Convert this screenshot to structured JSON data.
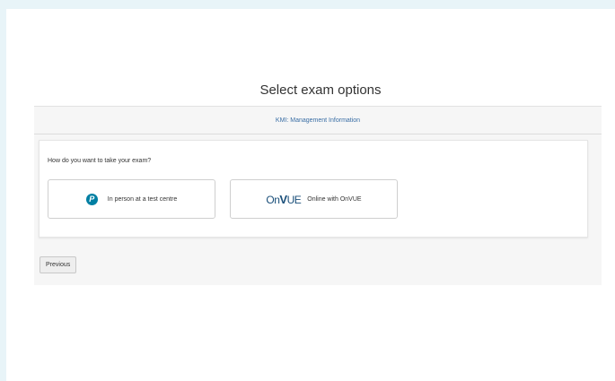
{
  "page": {
    "title": "Select exam options"
  },
  "exam": {
    "name": "KMI: Management Information"
  },
  "question": {
    "text": "How do you want to take your exam?",
    "options": [
      {
        "label": "In person at a test centre",
        "icon": "pearson-icon"
      },
      {
        "label": "Online with OnVUE",
        "icon": "onvue-logo",
        "logo_prefix": "On",
        "logo_v": "V",
        "logo_suffix": "UE"
      }
    ]
  },
  "nav": {
    "previous_label": "Previous"
  },
  "colors": {
    "background": "#e8f4f8",
    "accent": "#3a6ea5",
    "pearson": "#007fa3"
  }
}
